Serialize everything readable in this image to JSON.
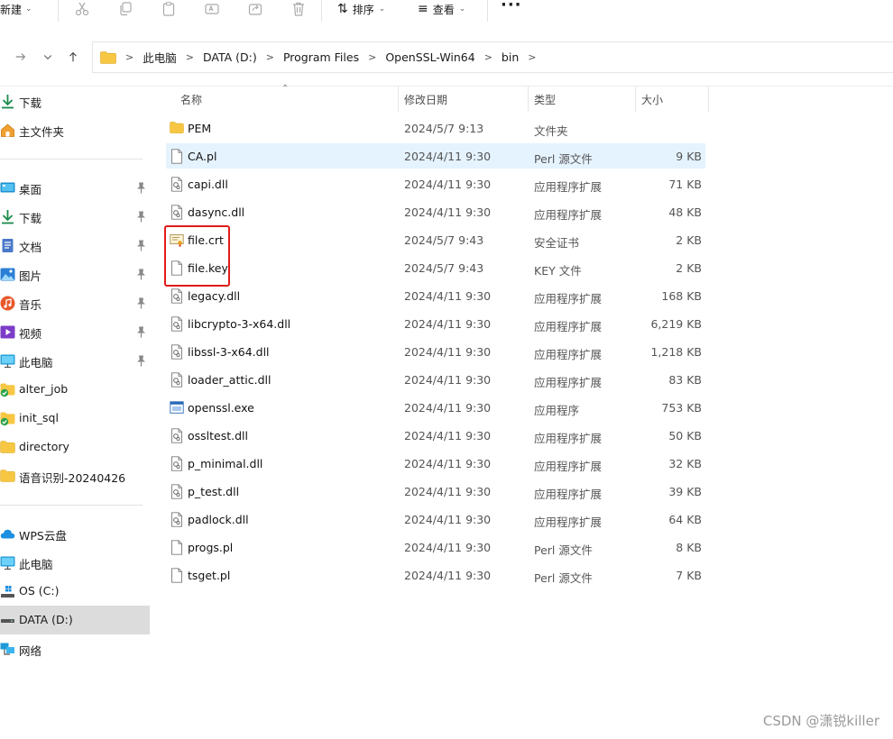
{
  "toolbar": {
    "new_label": "新建",
    "sort_label": "排序",
    "view_label": "查看",
    "more_label": "···",
    "icons": [
      "cut-icon",
      "copy-icon",
      "paste-icon",
      "rename-icon",
      "share-icon",
      "delete-icon"
    ]
  },
  "breadcrumb": [
    "此电脑",
    "DATA (D:)",
    "Program Files",
    "OpenSSL-Win64",
    "bin"
  ],
  "sidebar": {
    "items": [
      {
        "label": "下载",
        "icon": "download-icon",
        "pinned": false
      },
      {
        "label": "主文件夹",
        "icon": "home-icon",
        "pinned": false
      },
      {
        "label": "桌面",
        "icon": "desktop-icon",
        "pinned": true
      },
      {
        "label": "下载",
        "icon": "download-icon",
        "pinned": true
      },
      {
        "label": "文档",
        "icon": "documents-icon",
        "pinned": true
      },
      {
        "label": "图片",
        "icon": "pictures-icon",
        "pinned": true
      },
      {
        "label": "音乐",
        "icon": "music-icon",
        "pinned": true
      },
      {
        "label": "视频",
        "icon": "videos-icon",
        "pinned": true
      },
      {
        "label": "此电脑",
        "icon": "computer-icon",
        "pinned": true
      },
      {
        "label": "alter_job",
        "icon": "folder-synced-icon",
        "pinned": false
      },
      {
        "label": "init_sql",
        "icon": "folder-synced-icon",
        "pinned": false
      },
      {
        "label": "directory",
        "icon": "folder-icon",
        "pinned": false
      },
      {
        "label": "语音识别-20240426",
        "icon": "folder-icon",
        "pinned": false
      },
      {
        "label": "WPS云盘",
        "icon": "cloud-icon",
        "pinned": false
      },
      {
        "label": "此电脑",
        "icon": "computer-icon",
        "pinned": false
      },
      {
        "label": "OS (C:)",
        "icon": "drive-os-icon",
        "pinned": false
      },
      {
        "label": "DATA (D:)",
        "icon": "drive-icon",
        "pinned": false,
        "selected": true
      },
      {
        "label": "网络",
        "icon": "network-icon",
        "pinned": false
      }
    ]
  },
  "columns": {
    "name": "名称",
    "date": "修改日期",
    "type": "类型",
    "size": "大小"
  },
  "files": [
    {
      "name": "PEM",
      "date": "2024/5/7 9:13",
      "type": "文件夹",
      "size": "",
      "icon": "folder-icon"
    },
    {
      "name": "CA.pl",
      "date": "2024/4/11 9:30",
      "type": "Perl 源文件",
      "size": "9 KB",
      "icon": "file-icon",
      "hover": true
    },
    {
      "name": "capi.dll",
      "date": "2024/4/11 9:30",
      "type": "应用程序扩展",
      "size": "71 KB",
      "icon": "dll-icon"
    },
    {
      "name": "dasync.dll",
      "date": "2024/4/11 9:30",
      "type": "应用程序扩展",
      "size": "48 KB",
      "icon": "dll-icon"
    },
    {
      "name": "file.crt",
      "date": "2024/5/7 9:43",
      "type": "安全证书",
      "size": "2 KB",
      "icon": "certificate-icon"
    },
    {
      "name": "file.key",
      "date": "2024/5/7 9:43",
      "type": "KEY 文件",
      "size": "2 KB",
      "icon": "file-icon"
    },
    {
      "name": "legacy.dll",
      "date": "2024/4/11 9:30",
      "type": "应用程序扩展",
      "size": "168 KB",
      "icon": "dll-icon"
    },
    {
      "name": "libcrypto-3-x64.dll",
      "date": "2024/4/11 9:30",
      "type": "应用程序扩展",
      "size": "6,219 KB",
      "icon": "dll-icon"
    },
    {
      "name": "libssl-3-x64.dll",
      "date": "2024/4/11 9:30",
      "type": "应用程序扩展",
      "size": "1,218 KB",
      "icon": "dll-icon"
    },
    {
      "name": "loader_attic.dll",
      "date": "2024/4/11 9:30",
      "type": "应用程序扩展",
      "size": "83 KB",
      "icon": "dll-icon"
    },
    {
      "name": "openssl.exe",
      "date": "2024/4/11 9:30",
      "type": "应用程序",
      "size": "753 KB",
      "icon": "exe-icon"
    },
    {
      "name": "ossltest.dll",
      "date": "2024/4/11 9:30",
      "type": "应用程序扩展",
      "size": "50 KB",
      "icon": "dll-icon"
    },
    {
      "name": "p_minimal.dll",
      "date": "2024/4/11 9:30",
      "type": "应用程序扩展",
      "size": "32 KB",
      "icon": "dll-icon"
    },
    {
      "name": "p_test.dll",
      "date": "2024/4/11 9:30",
      "type": "应用程序扩展",
      "size": "39 KB",
      "icon": "dll-icon"
    },
    {
      "name": "padlock.dll",
      "date": "2024/4/11 9:30",
      "type": "应用程序扩展",
      "size": "64 KB",
      "icon": "dll-icon"
    },
    {
      "name": "progs.pl",
      "date": "2024/4/11 9:30",
      "type": "Perl 源文件",
      "size": "8 KB",
      "icon": "file-icon"
    },
    {
      "name": "tsget.pl",
      "date": "2024/4/11 9:30",
      "type": "Perl 源文件",
      "size": "7 KB",
      "icon": "file-icon"
    }
  ],
  "annotation_color": "#e01b1b",
  "watermark": "CSDN @潇锐killer"
}
